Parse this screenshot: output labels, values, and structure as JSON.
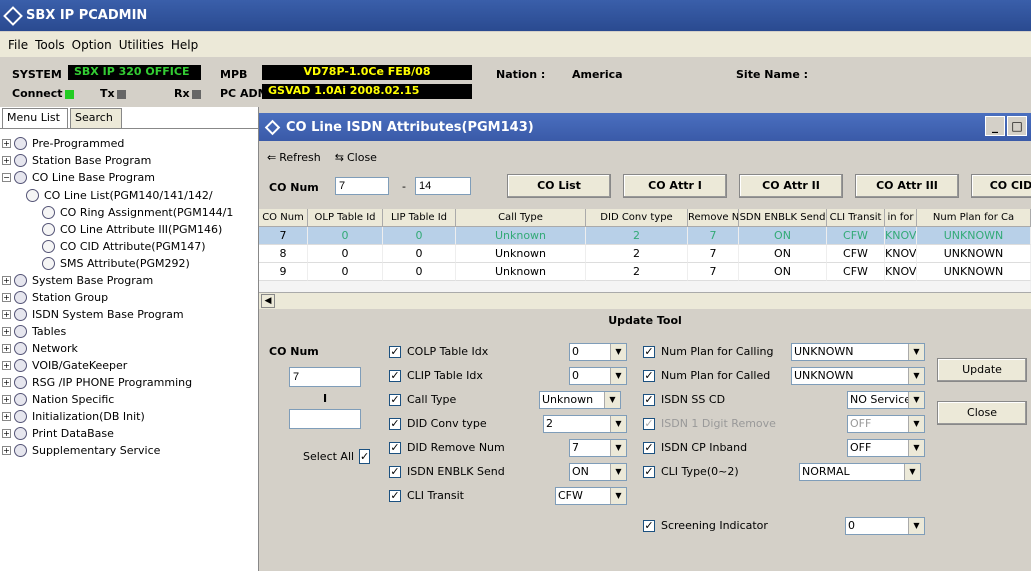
{
  "window": {
    "title": "SBX IP PCADMIN"
  },
  "menu": [
    "File",
    "Tools",
    "Option",
    "Utilities",
    "Help"
  ],
  "status": {
    "system_label": "SYSTEM",
    "system_value": "SBX IP 320 OFFICE",
    "mpb_label": "MPB",
    "mpb_value": "VD78P-1.0Ce FEB/08",
    "pcadm_label": "PC ADM",
    "pcadm_value": "GSVAD 1.0Ai 2008.02.15",
    "nation_label": "Nation :",
    "nation_value": "America",
    "site_label": "Site Name :",
    "site_value": "",
    "connect": "Connect",
    "tx": "Tx",
    "rx": "Rx"
  },
  "tabs": [
    "Menu List",
    "Search"
  ],
  "tree": [
    "Pre-Programmed",
    "Station Base Program",
    "CO Line Base Program",
    "CO Line List(PGM140/141/142/",
    "CO Ring Assignment(PGM144/1",
    "CO Line Attribute III(PGM146)",
    "CO CID Attribute(PGM147)",
    "SMS Attribute(PGM292)",
    "System Base Program",
    "Station Group",
    "ISDN System Base Program",
    "Tables",
    "Network",
    "VOIB/GateKeeper",
    "RSG /IP PHONE Programming",
    "Nation Specific",
    "Initialization(DB Init)",
    "Print DataBase",
    "Supplementary Service"
  ],
  "child": {
    "title": "CO Line ISDN Attributes(PGM143)",
    "refresh": "Refresh",
    "close": "Close",
    "co_num_label": "CO Num",
    "co_from": "7",
    "dash": "-",
    "co_to": "14",
    "buttons": [
      "CO List",
      "CO Attr I",
      "CO Attr II",
      "CO Attr III",
      "CO CID"
    ]
  },
  "grid": {
    "headers": [
      "CO Num",
      "OLP Table Id",
      "LIP Table Id",
      "Call Type",
      "DID Conv type",
      "Remove N",
      "SDN ENBLK Send",
      "CLI Transit",
      "in for",
      "Num Plan for Ca"
    ],
    "rows": [
      [
        "7",
        "0",
        "0",
        "Unknown",
        "2",
        "7",
        "ON",
        "CFW",
        "KNOV",
        "UNKNOWN"
      ],
      [
        "8",
        "0",
        "0",
        "Unknown",
        "2",
        "7",
        "ON",
        "CFW",
        "KNOV",
        "UNKNOWN"
      ],
      [
        "9",
        "0",
        "0",
        "Unknown",
        "2",
        "7",
        "ON",
        "CFW",
        "KNOV",
        "UNKNOWN"
      ]
    ]
  },
  "update": {
    "title": "Update Tool",
    "co_num": "CO Num",
    "co_val": "7",
    "sep": "I",
    "co_val2": "",
    "select_all": "Select All",
    "update_btn": "Update",
    "close_btn": "Close",
    "fields": [
      {
        "label": "COLP Table Idx",
        "value": "0",
        "checked": true
      },
      {
        "label": "CLIP Table Idx",
        "value": "0",
        "checked": true
      },
      {
        "label": "Call Type",
        "value": "Unknown",
        "checked": true
      },
      {
        "label": "DID Conv type",
        "value": "2",
        "checked": true
      },
      {
        "label": "DID Remove Num",
        "value": "7",
        "checked": true
      },
      {
        "label": "ISDN ENBLK Send",
        "value": "ON",
        "checked": true
      },
      {
        "label": "CLI Transit",
        "value": "CFW",
        "checked": true
      },
      {
        "label": "Num Plan for Calling",
        "value": "UNKNOWN",
        "checked": true
      },
      {
        "label": "Num Plan for Called",
        "value": "UNKNOWN",
        "checked": true
      },
      {
        "label": "ISDN SS CD",
        "value": "NO Service",
        "checked": true
      },
      {
        "label": "ISDN 1 Digit Remove",
        "value": "OFF",
        "checked": true
      },
      {
        "label": "ISDN CP Inband",
        "value": "OFF",
        "checked": true
      },
      {
        "label": "CLI Type(0~2)",
        "value": "NORMAL",
        "checked": true
      },
      {
        "label": "Screening Indicator",
        "value": "0",
        "checked": true
      }
    ]
  }
}
